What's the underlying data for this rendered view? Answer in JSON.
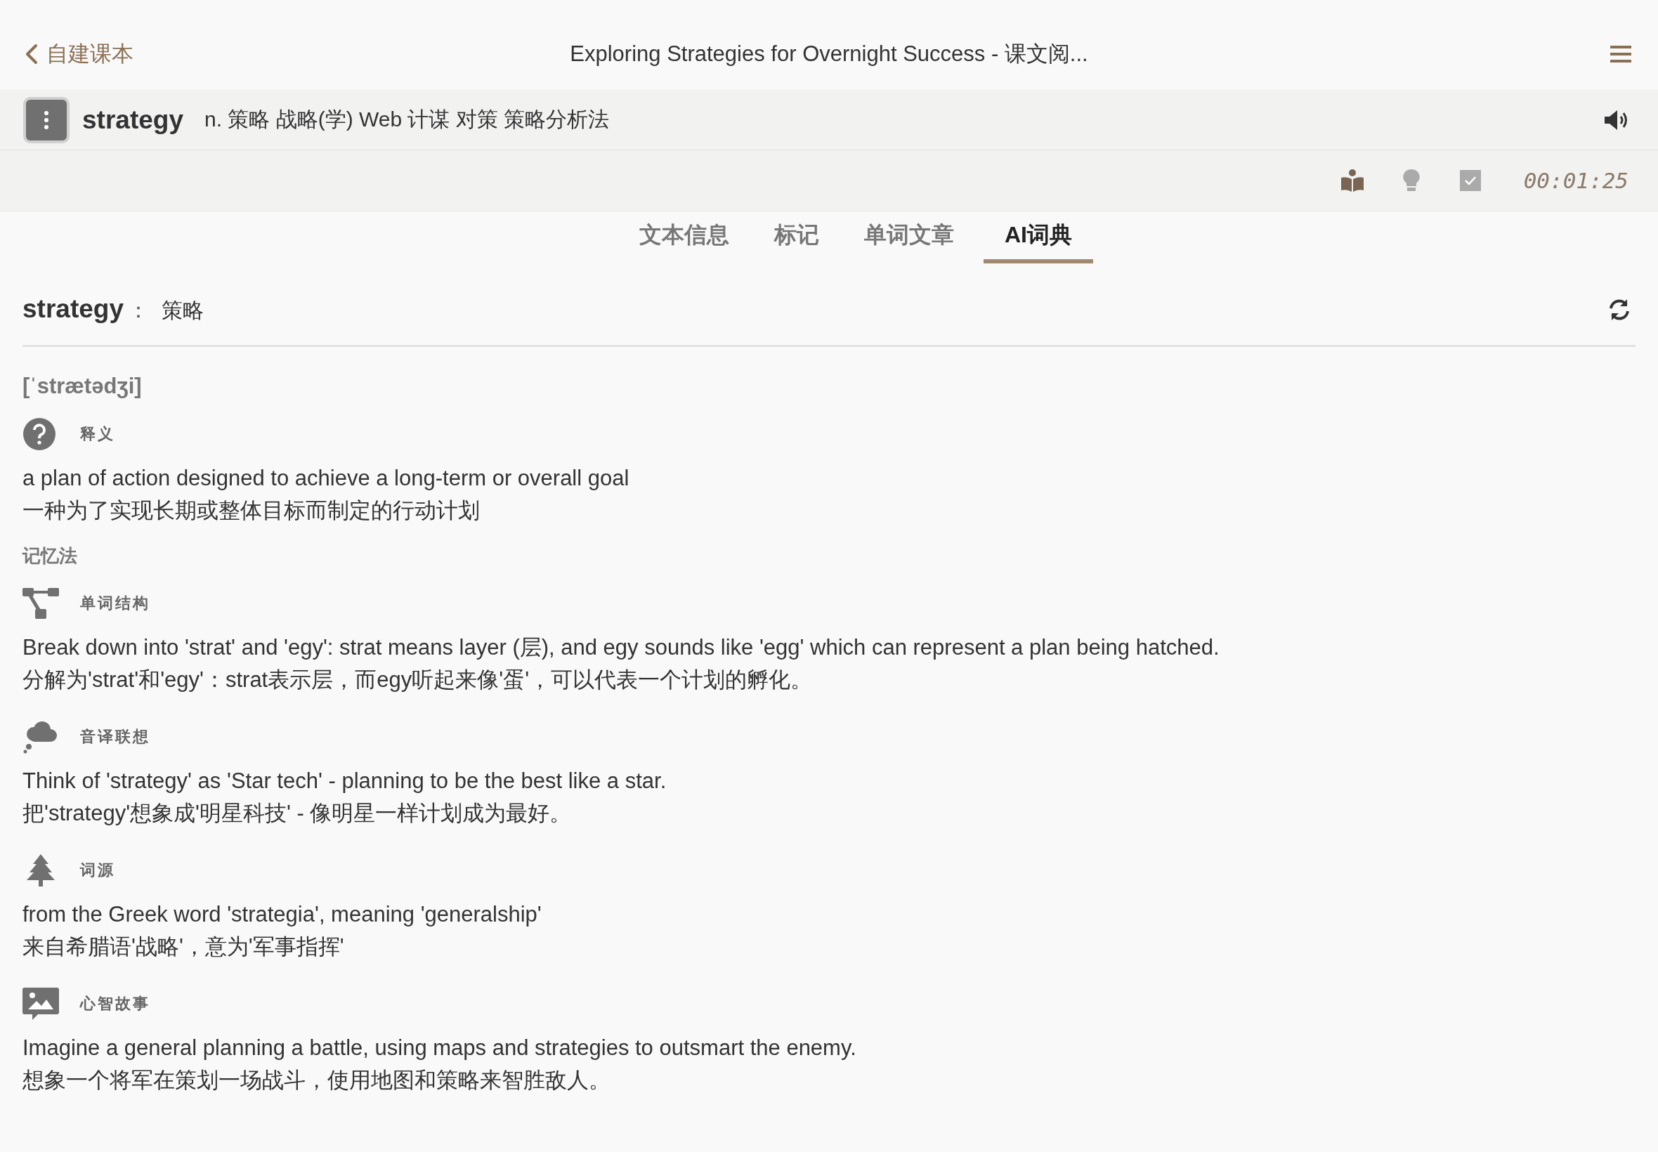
{
  "header": {
    "back": "自建课本",
    "title": "Exploring Strategies for Overnight Success - 课文阅..."
  },
  "word_bar": {
    "word": "strategy",
    "definition": "n. 策略 战略(学) Web 计谋 对策 策略分析法"
  },
  "toolbar": {
    "timer": "00:01:25"
  },
  "tabs": [
    {
      "label": "文本信息",
      "selected": false
    },
    {
      "label": "标记",
      "selected": false
    },
    {
      "label": "单词文章",
      "selected": false
    },
    {
      "label": "AI词典",
      "selected": true
    }
  ],
  "dictionary": {
    "headword": "strategy",
    "separator": "：",
    "translation": "策略",
    "phonetic": "[ˈstrætədʒi]",
    "meaning": {
      "kind": "question",
      "label": "释义",
      "en": "a plan of action designed to achieve a long-term or overall goal",
      "zh": "一种为了实现长期或整体目标而制定的行动计划"
    },
    "memory": {
      "heading": "记忆法",
      "items": [
        {
          "kind": "structure",
          "label": "单词结构",
          "en": "Break down into 'strat' and 'egy': strat means layer (层), and egy sounds like 'egg' which can represent a plan being hatched.",
          "zh": "分解为'strat'和'egy'：strat表示层，而egy听起来像'蛋'，可以代表一个计划的孵化。"
        },
        {
          "kind": "thought",
          "label": "音译联想",
          "en": "Think of 'strategy' as 'Star tech' - planning to be the best like a star.",
          "zh": "把'strategy'想象成'明星科技' - 像明星一样计划成为最好。"
        },
        {
          "kind": "tree",
          "label": "词源",
          "en": "from the Greek word 'strategia', meaning 'generalship'",
          "zh": "来自希腊语'战略'，意为'军事指挥'"
        },
        {
          "kind": "image",
          "label": "心智故事",
          "en": "Imagine a general planning a battle, using maps and strategies to outsmart the enemy.",
          "zh": "想象一个将军在策划一场战斗，使用地图和策略来智胜敌人。"
        }
      ]
    }
  }
}
